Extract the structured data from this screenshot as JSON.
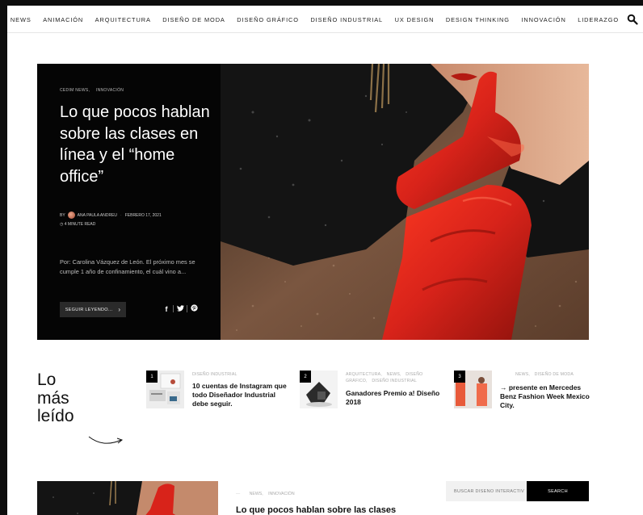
{
  "nav": {
    "items": [
      "NEWS",
      "ANIMACIÓN",
      "ARQUITECTURA",
      "DISEÑO DE MODA",
      "DISEÑO GRÁFICO",
      "DISEÑO INDUSTRIAL",
      "UX DESIGN",
      "DESIGN THINKING",
      "INNOVACIÓN",
      "LIDERAZGO"
    ],
    "search_icon": "search-icon"
  },
  "hero": {
    "categories": [
      "CEDIM NEWS,",
      "INNOVACIÓN"
    ],
    "title": "Lo que pocos hablan sobre las clases en línea y el “home office”",
    "by": "BY",
    "author": "ANA PAULA ANDREU",
    "date": "FEBRERO 17, 2021",
    "read_time": "◷ 4 MINUTE READ",
    "excerpt": "Por: Carolina Vázquez de León. El próximo mes se cumple 1 año de confinamiento, el cuál vino a...",
    "button_label": "SEGUIR LEYENDO...",
    "social": [
      "f",
      "t",
      "p"
    ]
  },
  "most_read": {
    "title_line1": "Lo",
    "title_line2": "más",
    "title_line3": "leído",
    "items": [
      {
        "num": "1",
        "categories": [
          "DISEÑO INDUSTRIAL"
        ],
        "title": "10 cuentas de Instagram que todo Diseñador Industrial debe seguir."
      },
      {
        "num": "2",
        "categories": [
          "ARQUITECTURA,",
          "NEWS,",
          "DISEÑO GRÁFICO,",
          "DISEÑO INDUSTRIAL"
        ],
        "title": "Ganadores Premio a! Diseño 2018"
      },
      {
        "num": "3",
        "categories": [
          "NEWS,",
          "DISEÑO DE MODA"
        ],
        "title": "→ presente en Mercedes Benz Fashion Week Mexico City."
      }
    ]
  },
  "bottom": {
    "categories": [
      "NEWS,",
      "INNOVACIÓN"
    ],
    "title": "Lo que pocos hablan sobre las clases",
    "search_placeholder": "BUSCAR DISEÑO INTERACTIV",
    "search_button": "SEARCH"
  },
  "colors": {
    "accent_red": "#d8231a",
    "dark": "#050505"
  }
}
